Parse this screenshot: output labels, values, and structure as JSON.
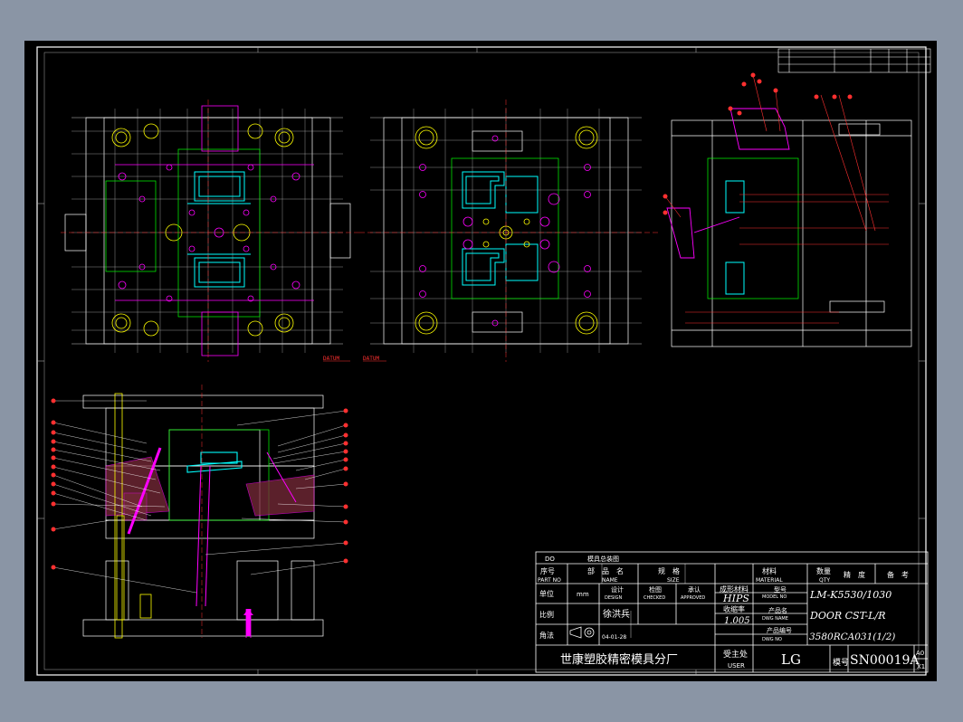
{
  "colors": {
    "background": "#8a95a5",
    "sheet": "#000000",
    "line": "#ffffff",
    "magenta": "#ff00ff",
    "cyan": "#00ffff",
    "green": "#00ff00",
    "red": "#ff3030",
    "yellow": "#ffff00"
  },
  "datum": {
    "left": "DATUM",
    "right": "DATUM"
  },
  "title_block": {
    "header_do": "DO",
    "header_title": "模具总装图",
    "col_no_cn": "序号",
    "col_no_en": "PART NO",
    "col_name_cn": "部　品　名",
    "col_name_en": "NAME",
    "col_size_cn": "规　格",
    "col_size_en": "SIZE",
    "col_material_cn": "材料",
    "col_material_en": "MATERIAL",
    "col_qty_cn": "数量",
    "col_qty_en": "QTY",
    "col_precision": "精　度",
    "col_remark": "备　考",
    "unit_label": "单位",
    "unit_value": "mm",
    "design_cn": "设计",
    "design_en": "DESIGN",
    "check_cn": "检图",
    "check_en": "CHECKED",
    "approve_cn": "承认",
    "approve_en": "APPROVED",
    "molding_material_label": "成形材料",
    "molding_material_value": "HIPS",
    "model_no_cn": "型号",
    "model_no_en": "MODEL NO",
    "model_no_value": "LM-K5530/1030",
    "scale_label": "比例",
    "designer": "徐洪兵",
    "shrink_label": "收缩率",
    "shrink_value": "1.005",
    "product_name_cn": "产品名",
    "product_name_en": "DWG NAME",
    "product_name_value": "DOOR CST-L/R",
    "angle_label": "角法",
    "date": "04-01-28",
    "product_code_cn": "产品编号",
    "product_code_en": "DWG NO",
    "product_code_value": "3580RCA031(1/2)",
    "company": "世康塑胶精密模具分厂",
    "client_cn": "受主处",
    "client_en": "USER",
    "client_value": "LG",
    "mold_no_label": "模号",
    "mold_no_value": "SN00019A",
    "sheet_size": "A0",
    "sheet_index": "X1"
  }
}
